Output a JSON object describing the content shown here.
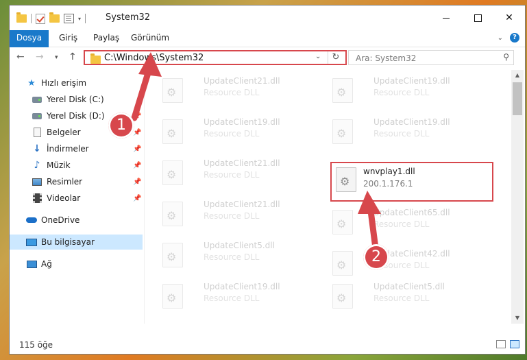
{
  "window": {
    "title": "System32",
    "min_label": "—",
    "close_label": "✕"
  },
  "ribbon": {
    "tabs": [
      "Dosya",
      "Giriş",
      "Paylaş",
      "Görünüm"
    ]
  },
  "address": {
    "path": "C:\\Windows\\System32"
  },
  "search": {
    "placeholder": "Ara: System32"
  },
  "sidebar": {
    "items": [
      {
        "label": "Hızlı erişim",
        "icon": "star-icon"
      },
      {
        "label": "Yerel Disk (C:)",
        "icon": "drive-icon",
        "pin": "📌"
      },
      {
        "label": "Yerel Disk (D:)",
        "icon": "drive-icon",
        "pin": "📌"
      },
      {
        "label": "Belgeler",
        "icon": "documents-icon",
        "pin": "📌"
      },
      {
        "label": "İndirmeler",
        "icon": "downloads-icon",
        "pin": "📌"
      },
      {
        "label": "Müzik",
        "icon": "music-icon",
        "pin": "📌"
      },
      {
        "label": "Resimler",
        "icon": "pictures-icon",
        "pin": "📌"
      },
      {
        "label": "Videolar",
        "icon": "videos-icon",
        "pin": "📌"
      },
      {
        "label": "OneDrive",
        "icon": "onedrive-icon"
      },
      {
        "label": "Bu bilgisayar",
        "icon": "this-pc-icon"
      },
      {
        "label": "Ağ",
        "icon": "network-icon"
      }
    ]
  },
  "files": [
    {
      "name": "UpdateClient21.dll",
      "meta": "Resource DLL"
    },
    {
      "name": "UpdateClient19.dll",
      "meta": "Resource DLL"
    },
    {
      "name": "UpdateClient19.dll",
      "meta": "Resource DLL"
    },
    {
      "name": "UpdateClient19.dll",
      "meta": "Resource DLL"
    },
    {
      "name": "UpdateClient21.dll",
      "meta": "Resource DLL"
    },
    {
      "name": "wnvplay1.dll",
      "meta": "200.1.176.1"
    },
    {
      "name": "UpdateClient21.dll",
      "meta": "Resource DLL"
    },
    {
      "name": "UpdateClient65.dll",
      "meta": "Resource DLL"
    },
    {
      "name": "UpdateClient5.dll",
      "meta": "Resource DLL"
    },
    {
      "name": "UpdateClient42.dll",
      "meta": "Resource DLL"
    },
    {
      "name": "UpdateClient19.dll",
      "meta": "Resource DLL"
    },
    {
      "name": "UpdateClient5.dll",
      "meta": "Resource DLL"
    }
  ],
  "status": {
    "item_count": "115 öğe"
  },
  "annotations": {
    "step1": "1",
    "step2": "2",
    "color": "#d7474c"
  }
}
